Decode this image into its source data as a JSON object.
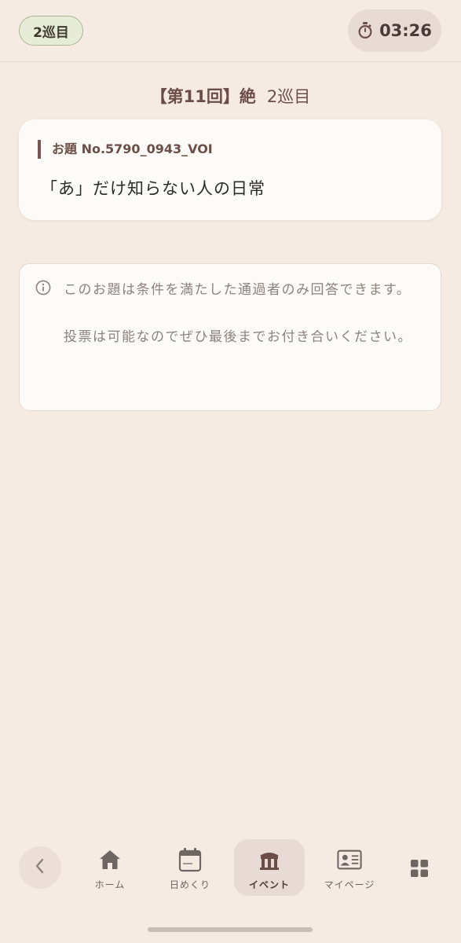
{
  "header": {
    "round_badge": "2巡目",
    "timer": "03:26",
    "timer_icon": "stopwatch-icon"
  },
  "event": {
    "title_main": "【第11回】絶",
    "title_sub": "2巡目"
  },
  "topic": {
    "label": "お題 No.5790_0943_VOI",
    "text": "「あ」だけ知らない人の日常"
  },
  "notice": {
    "icon": "info-icon",
    "line1": "このお題は条件を満たした通過者のみ回答できます。",
    "line2": "投票は可能なのでぜひ最後までお付き合いください。"
  },
  "nav": {
    "back_icon": "chevron-left-icon",
    "items": [
      {
        "label": "ホーム",
        "icon": "home-icon"
      },
      {
        "label": "日めくり",
        "icon": "calendar-icon"
      },
      {
        "label": "イベント",
        "icon": "event-icon",
        "active": true
      },
      {
        "label": "マイページ",
        "icon": "id-card-icon"
      }
    ],
    "menu_icon": "grid-icon"
  },
  "colors": {
    "background": "#f5ebe3",
    "card": "#fdfbf8",
    "accent": "#7b5650",
    "round_badge_bg": "#e6ecd8",
    "active_nav_bg": "#e8dad4"
  }
}
